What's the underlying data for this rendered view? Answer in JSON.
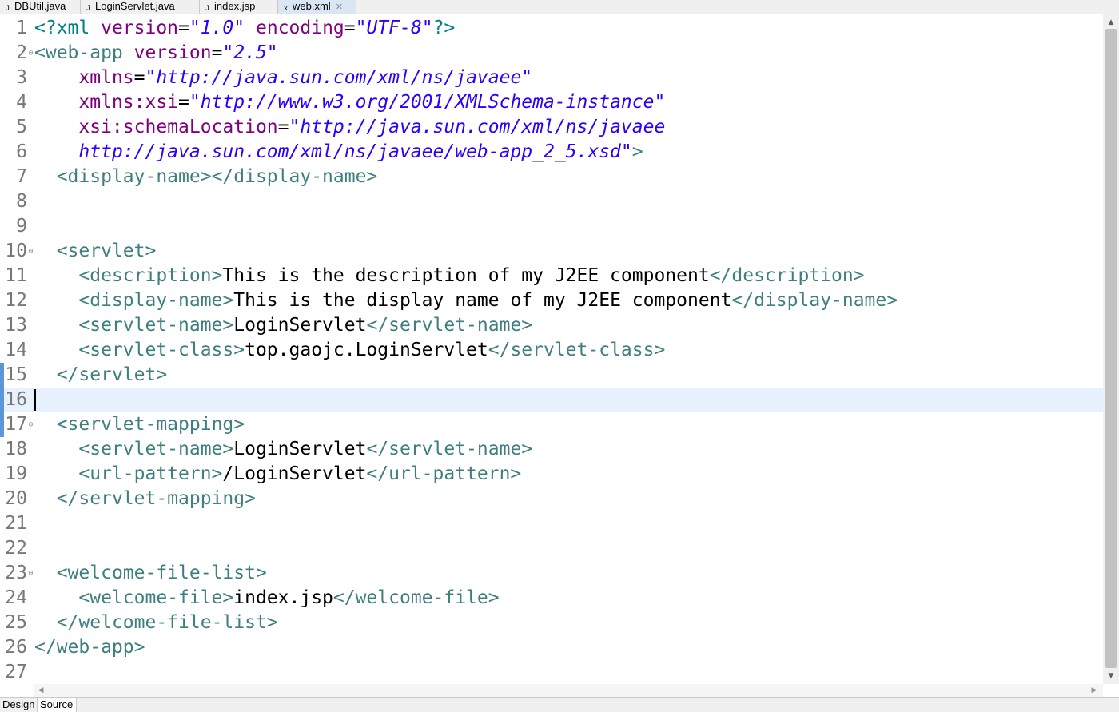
{
  "tabs": [
    {
      "label": "DBUtil.java",
      "icon": "java-file-icon"
    },
    {
      "label": "LoginServlet.java",
      "icon": "java-file-icon"
    },
    {
      "label": "index.jsp",
      "icon": "jsp-file-icon"
    },
    {
      "label": "web.xml",
      "icon": "xml-file-icon",
      "active": true,
      "close": "✕"
    }
  ],
  "editor": {
    "current_line": 16,
    "lines": [
      {
        "n": "1",
        "fold": "",
        "segs": [
          [
            "pi",
            "<?xml "
          ],
          [
            "attr",
            "version"
          ],
          [
            "text",
            "="
          ],
          [
            "str",
            "\"1.0\""
          ],
          [
            "text",
            " "
          ],
          [
            "attr",
            "encoding"
          ],
          [
            "text",
            "="
          ],
          [
            "str",
            "\"UTF-8\""
          ],
          [
            "pi",
            "?>"
          ]
        ]
      },
      {
        "n": "2",
        "fold": "⊖",
        "segs": [
          [
            "tag",
            "<web-app "
          ],
          [
            "attr",
            "version"
          ],
          [
            "text",
            "="
          ],
          [
            "str",
            "\"2.5\""
          ]
        ]
      },
      {
        "n": "3",
        "fold": "",
        "segs": [
          [
            "text",
            "    "
          ],
          [
            "attr",
            "xmlns"
          ],
          [
            "text",
            "="
          ],
          [
            "str",
            "\"http://java.sun.com/xml/ns/javaee\""
          ]
        ]
      },
      {
        "n": "4",
        "fold": "",
        "segs": [
          [
            "text",
            "    "
          ],
          [
            "attr",
            "xmlns:xsi"
          ],
          [
            "text",
            "="
          ],
          [
            "str",
            "\"http://www.w3.org/2001/XMLSchema-instance\""
          ]
        ]
      },
      {
        "n": "5",
        "fold": "",
        "segs": [
          [
            "text",
            "    "
          ],
          [
            "attr",
            "xsi:schemaLocation"
          ],
          [
            "text",
            "="
          ],
          [
            "str",
            "\"http://java.sun.com/xml/ns/javaee"
          ]
        ]
      },
      {
        "n": "6",
        "fold": "",
        "segs": [
          [
            "text",
            "    "
          ],
          [
            "str",
            "http://java.sun.com/xml/ns/javaee/web-app_2_5.xsd\""
          ],
          [
            "tag",
            ">"
          ]
        ]
      },
      {
        "n": "7",
        "fold": "",
        "segs": [
          [
            "text",
            "  "
          ],
          [
            "tag",
            "<display-name></display-name>"
          ]
        ]
      },
      {
        "n": "8",
        "fold": "",
        "segs": []
      },
      {
        "n": "9",
        "fold": "",
        "segs": []
      },
      {
        "n": "10",
        "fold": "⊖",
        "segs": [
          [
            "text",
            "  "
          ],
          [
            "tag",
            "<servlet>"
          ]
        ]
      },
      {
        "n": "11",
        "fold": "",
        "segs": [
          [
            "text",
            "    "
          ],
          [
            "tag",
            "<description>"
          ],
          [
            "text",
            "This is the description of my J2EE component"
          ],
          [
            "tag",
            "</description>"
          ]
        ]
      },
      {
        "n": "12",
        "fold": "",
        "segs": [
          [
            "text",
            "    "
          ],
          [
            "tag",
            "<display-name>"
          ],
          [
            "text",
            "This is the display name of my J2EE component"
          ],
          [
            "tag",
            "</display-name>"
          ]
        ]
      },
      {
        "n": "13",
        "fold": "",
        "segs": [
          [
            "text",
            "    "
          ],
          [
            "tag",
            "<servlet-name>"
          ],
          [
            "text",
            "LoginServlet"
          ],
          [
            "tag",
            "</servlet-name>"
          ]
        ]
      },
      {
        "n": "14",
        "fold": "",
        "segs": [
          [
            "text",
            "    "
          ],
          [
            "tag",
            "<servlet-class>"
          ],
          [
            "text",
            "top.gaojc.LoginServlet"
          ],
          [
            "tag",
            "</servlet-class>"
          ]
        ]
      },
      {
        "n": "15",
        "fold": "",
        "segs": [
          [
            "text",
            "  "
          ],
          [
            "tag",
            "</servlet>"
          ]
        ]
      },
      {
        "n": "16",
        "fold": "",
        "segs": []
      },
      {
        "n": "17",
        "fold": "⊖",
        "segs": [
          [
            "text",
            "  "
          ],
          [
            "tag",
            "<servlet-mapping>"
          ]
        ]
      },
      {
        "n": "18",
        "fold": "",
        "segs": [
          [
            "text",
            "    "
          ],
          [
            "tag",
            "<servlet-name>"
          ],
          [
            "text",
            "LoginServlet"
          ],
          [
            "tag",
            "</servlet-name>"
          ]
        ]
      },
      {
        "n": "19",
        "fold": "",
        "segs": [
          [
            "text",
            "    "
          ],
          [
            "tag",
            "<url-pattern>"
          ],
          [
            "text",
            "/LoginServlet"
          ],
          [
            "tag",
            "</url-pattern>"
          ]
        ]
      },
      {
        "n": "20",
        "fold": "",
        "segs": [
          [
            "text",
            "  "
          ],
          [
            "tag",
            "</servlet-mapping>"
          ]
        ]
      },
      {
        "n": "21",
        "fold": "",
        "segs": []
      },
      {
        "n": "22",
        "fold": "",
        "segs": []
      },
      {
        "n": "23",
        "fold": "⊖",
        "segs": [
          [
            "text",
            "  "
          ],
          [
            "tag",
            "<welcome-file-list>"
          ]
        ]
      },
      {
        "n": "24",
        "fold": "",
        "segs": [
          [
            "text",
            "    "
          ],
          [
            "tag",
            "<welcome-file>"
          ],
          [
            "text",
            "index.jsp"
          ],
          [
            "tag",
            "</welcome-file>"
          ]
        ]
      },
      {
        "n": "25",
        "fold": "",
        "segs": [
          [
            "text",
            "  "
          ],
          [
            "tag",
            "</welcome-file-list>"
          ]
        ]
      },
      {
        "n": "26",
        "fold": "",
        "segs": [
          [
            "tag",
            "</web-app>"
          ]
        ]
      },
      {
        "n": "27",
        "fold": "",
        "segs": []
      }
    ]
  },
  "scrollbar": {
    "up": "▲",
    "down": "▼",
    "left": "◀",
    "right": "▶"
  },
  "bottom_tabs": [
    {
      "label": "Design"
    },
    {
      "label": "Source",
      "active": true
    }
  ],
  "colors": {
    "tag": "#3f7f7f",
    "attr": "#7f007f",
    "string": "#2a00ff",
    "processing_instruction": "#008080",
    "text": "#000000",
    "current_line": "#e8f2fe"
  }
}
